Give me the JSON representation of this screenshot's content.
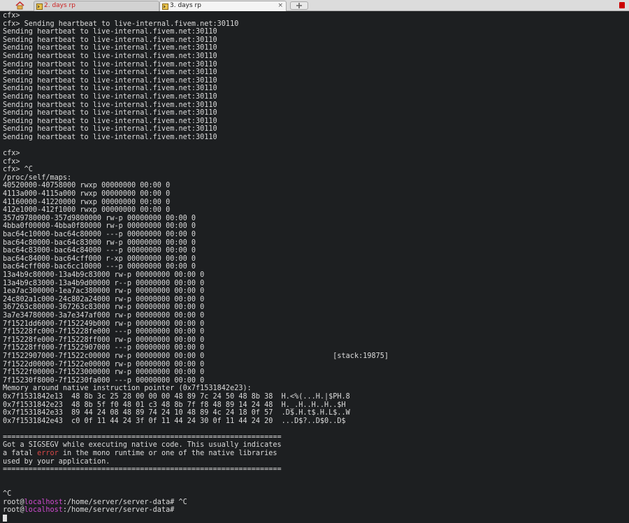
{
  "tabs": [
    {
      "label": "2. days rp",
      "active": false,
      "color": "#cc2222"
    },
    {
      "label": "3. days rp",
      "active": true,
      "close": "×"
    }
  ],
  "colors": {
    "background": "#1d1f21",
    "text": "#dcdcdc",
    "error": "#d64747",
    "hostname": "#d04bd0"
  },
  "terminal": {
    "lines": [
      "cfx>",
      "cfx> Sending heartbeat to live-internal.fivem.net:30110",
      "Sending heartbeat to live-internal.fivem.net:30110",
      "Sending heartbeat to live-internal.fivem.net:30110",
      "Sending heartbeat to live-internal.fivem.net:30110",
      "Sending heartbeat to live-internal.fivem.net:30110",
      "Sending heartbeat to live-internal.fivem.net:30110",
      "Sending heartbeat to live-internal.fivem.net:30110",
      "Sending heartbeat to live-internal.fivem.net:30110",
      "Sending heartbeat to live-internal.fivem.net:30110",
      "Sending heartbeat to live-internal.fivem.net:30110",
      "Sending heartbeat to live-internal.fivem.net:30110",
      "Sending heartbeat to live-internal.fivem.net:30110",
      "Sending heartbeat to live-internal.fivem.net:30110",
      "Sending heartbeat to live-internal.fivem.net:30110",
      "Sending heartbeat to live-internal.fivem.net:30110",
      "",
      "cfx>",
      "cfx>",
      "cfx> ^C",
      "/proc/self/maps:",
      "40520000-40758000 rwxp 00000000 00:00 0",
      "4113a000-4115a000 rwxp 00000000 00:00 0",
      "41160000-41220000 rwxp 00000000 00:00 0",
      "412e1000-412f1000 rwxp 00000000 00:00 0",
      "357d9780000-357d9800000 rw-p 00000000 00:00 0",
      "4bba0f00000-4bba0f80000 rw-p 00000000 00:00 0",
      "bac64c10000-bac64c80000 ---p 00000000 00:00 0",
      "bac64c80000-bac64c83000 rw-p 00000000 00:00 0",
      "bac64c83000-bac64c84000 ---p 00000000 00:00 0",
      "bac64c84000-bac64cff000 r-xp 00000000 00:00 0",
      "bac64cff000-bac6cc10000 ---p 00000000 00:00 0",
      "13a4b9c80000-13a4b9c83000 rw-p 00000000 00:00 0",
      "13a4b9c83000-13a4b9d00000 r--p 00000000 00:00 0",
      "1ea7ac300000-1ea7ac380000 rw-p 00000000 00:00 0",
      "24c802a1c000-24c802a24000 rw-p 00000000 00:00 0",
      "367263c80000-367263c83000 rw-p 00000000 00:00 0",
      "3a7e34780000-3a7e347af000 rw-p 00000000 00:00 0",
      "7f1521dd6000-7f152249b000 rw-p 00000000 00:00 0",
      "7f15228fc000-7f15228fe000 ---p 00000000 00:00 0",
      "7f15228fe000-7f15228ff000 rw-p 00000000 00:00 0",
      "7f15228ff000-7f1522907000 ---p 00000000 00:00 0",
      "7f1522907000-7f1522c00000 rw-p 00000000 00:00 0                              [stack:19875]",
      "7f1522d00000-7f1522e00000 rw-p 00000000 00:00 0",
      "7f1522f00000-7f1523000000 rw-p 00000000 00:00 0",
      "7f15230f8000-7f15230fa000 ---p 00000000 00:00 0",
      "Memory around native instruction pointer (0x7f1531842e23):",
      "0x7f1531842e13  48 8b 3c 25 28 00 00 00 48 89 7c 24 50 48 8b 38  H.<%(...H.|$PH.8",
      "0x7f1531842e23  48 8b 5f f0 48 01 c3 48 8b 7f f8 48 89 14 24 48  H._.H..H..H..$H",
      "0x7f1531842e33  89 44 24 08 48 89 74 24 10 48 89 4c 24 18 0f 57  .D$.H.t$.H.L$..W",
      "0x7f1531842e43  c0 0f 11 44 24 3f 0f 11 44 24 30 0f 11 44 24 20  ...D$?..D$0..D$",
      "",
      "=================================================================",
      "Got a SIGSEGV while executing native code. This usually indicates",
      "a fatal error in the mono runtime or one of the native libraries",
      "used by your application.",
      "=================================================================",
      "",
      "",
      "^C",
      "root@localhost:/home/server/server-data# ^C",
      "root@localhost:/home/server/server-data# "
    ]
  }
}
